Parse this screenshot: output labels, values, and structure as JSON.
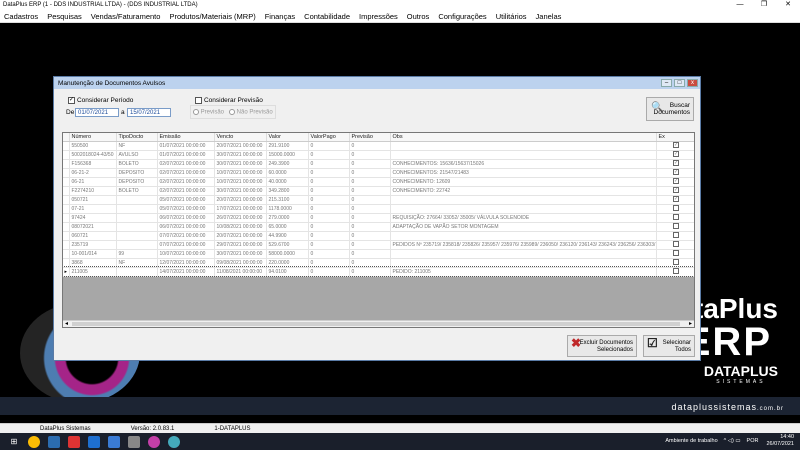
{
  "app": {
    "title": "DataPlus ERP (1 - DDS INDUSTRIAL LTDA) - (DDS INDUSTRIAL LTDA)",
    "controls": [
      "—",
      "❐",
      "✕"
    ]
  },
  "menu": [
    "Cadastros",
    "Pesquisas",
    "Vendas/Faturamento",
    "Produtos/Materiais (MRP)",
    "Finanças",
    "Contabilidade",
    "Impressões",
    "Outros",
    "Configurações",
    "Utilitários",
    "Janelas"
  ],
  "dialog": {
    "title": "Manutenção de Documentos Avulsos",
    "considerar_periodo": "Considerar Período",
    "de_label": "De",
    "date_from": "01/07/2021",
    "a_label": "a",
    "date_to": "15/07/2021",
    "considerar_previsao": "Considerar Previsão",
    "previsao": "Previsão",
    "nao_previsao": "Não Previsão",
    "buscar": "Buscar",
    "documentos": "Documentos",
    "excluir_1": "Excluir Documentos",
    "excluir_2": "Selecionados",
    "selecionar_1": "Selecionar",
    "selecionar_2": "Todos"
  },
  "grid": {
    "columns": [
      "Número",
      "TipoDocto",
      "Emissão",
      "Vencto",
      "Valor",
      "ValorPago",
      "Previsão",
      "Obs",
      "Ex"
    ],
    "rows": [
      {
        "numero": "550500",
        "tipo": "NF",
        "emissao": "01/07/2021 00:00:00",
        "vencto": "20/07/2021 00:00:00",
        "valor": "291.9100",
        "pago": "0",
        "prev": "0",
        "obs": "",
        "ex": true
      },
      {
        "numero": "5002018024-43/50",
        "tipo": "AVULSO",
        "emissao": "01/07/2021 00:00:00",
        "vencto": "30/07/2021 00:00:00",
        "valor": "15000.0000",
        "pago": "0",
        "prev": "0",
        "obs": "",
        "ex": true
      },
      {
        "numero": "F156368",
        "tipo": "BOLETO",
        "emissao": "02/07/2021 00:00:00",
        "vencto": "30/07/2021 00:00:00",
        "valor": "249.3900",
        "pago": "0",
        "prev": "0",
        "obs": "CONHECIMENTOS: 15636/15637/15026",
        "ex": true
      },
      {
        "numero": "06-21-2",
        "tipo": "DEPOSITO",
        "emissao": "02/07/2021 00:00:00",
        "vencto": "10/07/2021 00:00:00",
        "valor": "60.0000",
        "pago": "0",
        "prev": "0",
        "obs": "CONHECIMENTOS: 21547/21483",
        "ex": true
      },
      {
        "numero": "06-21",
        "tipo": "DEPOSITO",
        "emissao": "02/07/2021 00:00:00",
        "vencto": "10/07/2021 00:00:00",
        "valor": "40.0000",
        "pago": "0",
        "prev": "0",
        "obs": "CONHECIMENTO: 12609",
        "ex": true
      },
      {
        "numero": "F2274210",
        "tipo": "BOLETO",
        "emissao": "02/07/2021 00:00:00",
        "vencto": "30/07/2021 00:00:00",
        "valor": "349.2800",
        "pago": "0",
        "prev": "0",
        "obs": "CONHECIMENTO: 22742",
        "ex": true
      },
      {
        "numero": "050721",
        "tipo": "",
        "emissao": "05/07/2021 00:00:00",
        "vencto": "20/07/2021 00:00:00",
        "valor": "215.3100",
        "pago": "0",
        "prev": "0",
        "obs": "",
        "ex": true
      },
      {
        "numero": "07-21",
        "tipo": "",
        "emissao": "05/07/2021 00:00:00",
        "vencto": "17/07/2021 00:00:00",
        "valor": "1178.0000",
        "pago": "0",
        "prev": "0",
        "obs": "",
        "ex": false
      },
      {
        "numero": "97424",
        "tipo": "",
        "emissao": "06/07/2021 00:00:00",
        "vencto": "26/07/2021 00:00:00",
        "valor": "279.0000",
        "pago": "0",
        "prev": "0",
        "obs": "REQUISIÇÃO: 27664/ 33052/ 35005/ VÁLVULA SOLENOIDE",
        "ex": false
      },
      {
        "numero": "08072021",
        "tipo": "",
        "emissao": "06/07/2021 00:00:00",
        "vencto": "10/08/2021 00:00:00",
        "valor": "65.0000",
        "pago": "0",
        "prev": "0",
        "obs": "ADAPTAÇÃO DE VAPÃO SETOR MONTAGEM",
        "ex": false
      },
      {
        "numero": "060721",
        "tipo": "",
        "emissao": "07/07/2021 00:00:00",
        "vencto": "20/07/2021 00:00:00",
        "valor": "44.9900",
        "pago": "0",
        "prev": "0",
        "obs": "",
        "ex": false
      },
      {
        "numero": "235719",
        "tipo": "",
        "emissao": "07/07/2021 00:00:00",
        "vencto": "29/07/2021 00:00:00",
        "valor": "529.6700",
        "pago": "0",
        "prev": "0",
        "obs": "PEDIDOS Nº 235719/ 235818/ 235826/ 235957/ 235976/ 235989/ 236050/ 236120/ 236143/ 236243/ 236256/ 236303/ 236574",
        "ex": false
      },
      {
        "numero": "10-001/014",
        "tipo": "99",
        "emissao": "10/07/2021 00:00:00",
        "vencto": "30/07/2021 00:00:00",
        "valor": "58000.0000",
        "pago": "0",
        "prev": "0",
        "obs": "",
        "ex": false
      },
      {
        "numero": "3868",
        "tipo": "NF",
        "emissao": "12/07/2021 00:00:00",
        "vencto": "09/08/2021 00:00:00",
        "valor": "220.0000",
        "pago": "0",
        "prev": "0",
        "obs": "",
        "ex": false
      },
      {
        "numero": "211005",
        "tipo": "",
        "emissao": "14/07/2021 00:00:00",
        "vencto": "11/08/2021 00:00:00",
        "valor": "94.0100",
        "pago": "0",
        "prev": "0",
        "obs": "PEDIDO: 211005",
        "ex": false,
        "current": true
      }
    ]
  },
  "brand": {
    "line1": "ataPlus",
    "line2": "ERP",
    "line3": "DATAPLUS",
    "line3_sub": "SISTEMAS",
    "site": "dataplussistemas",
    "site_tld": ".com.br"
  },
  "statusbar": {
    "system": "DataPlus Sistemas",
    "version": "Versão: 2.0.83.1",
    "company": "1-DATAPLUS"
  },
  "taskbar": {
    "env": "Ambiente de trabalho",
    "lang": "POR",
    "time": "14:40",
    "date": "26/07/2021",
    "tray": "^  ◁)  ▭"
  }
}
